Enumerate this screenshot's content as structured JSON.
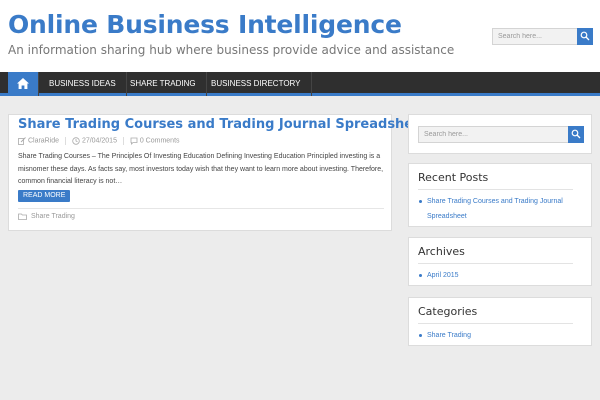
{
  "header": {
    "site_title": "Online Business Intelligence",
    "site_description": "An information sharing hub where business provide advice and assistance",
    "search_placeholder": "Search here..."
  },
  "nav": {
    "home_icon": "home-icon",
    "items": [
      {
        "label": "BUSINESS IDEAS"
      },
      {
        "label": "SHARE TRADING"
      },
      {
        "label": "BUSINESS DIRECTORY"
      }
    ]
  },
  "post": {
    "title": "Share Trading Courses and Trading Journal Spreadsheet",
    "author": "ClaraRide",
    "date": "27/04/2015",
    "comments": "0 Comments",
    "excerpt": "Share Trading Courses – The Principles Of Investing Education Defining Investing Education Principled investing is a misnomer these days. As facts say, most investors today wish that they want to learn more about investing. Therefore, common financial literacy is not…",
    "read_more": "READ MORE",
    "category": "Share Trading"
  },
  "sidebar": {
    "search_placeholder": "Search here...",
    "recent_posts": {
      "title": "Recent Posts",
      "items": [
        "Share Trading Courses and Trading Journal Spreadsheet"
      ]
    },
    "archives": {
      "title": "Archives",
      "items": [
        "April 2015"
      ]
    },
    "categories": {
      "title": "Categories",
      "items": [
        "Share Trading"
      ]
    }
  },
  "colors": {
    "accent": "#3a7bc8",
    "nav_background": "#2f2f2f",
    "page_background": "#ececec"
  }
}
